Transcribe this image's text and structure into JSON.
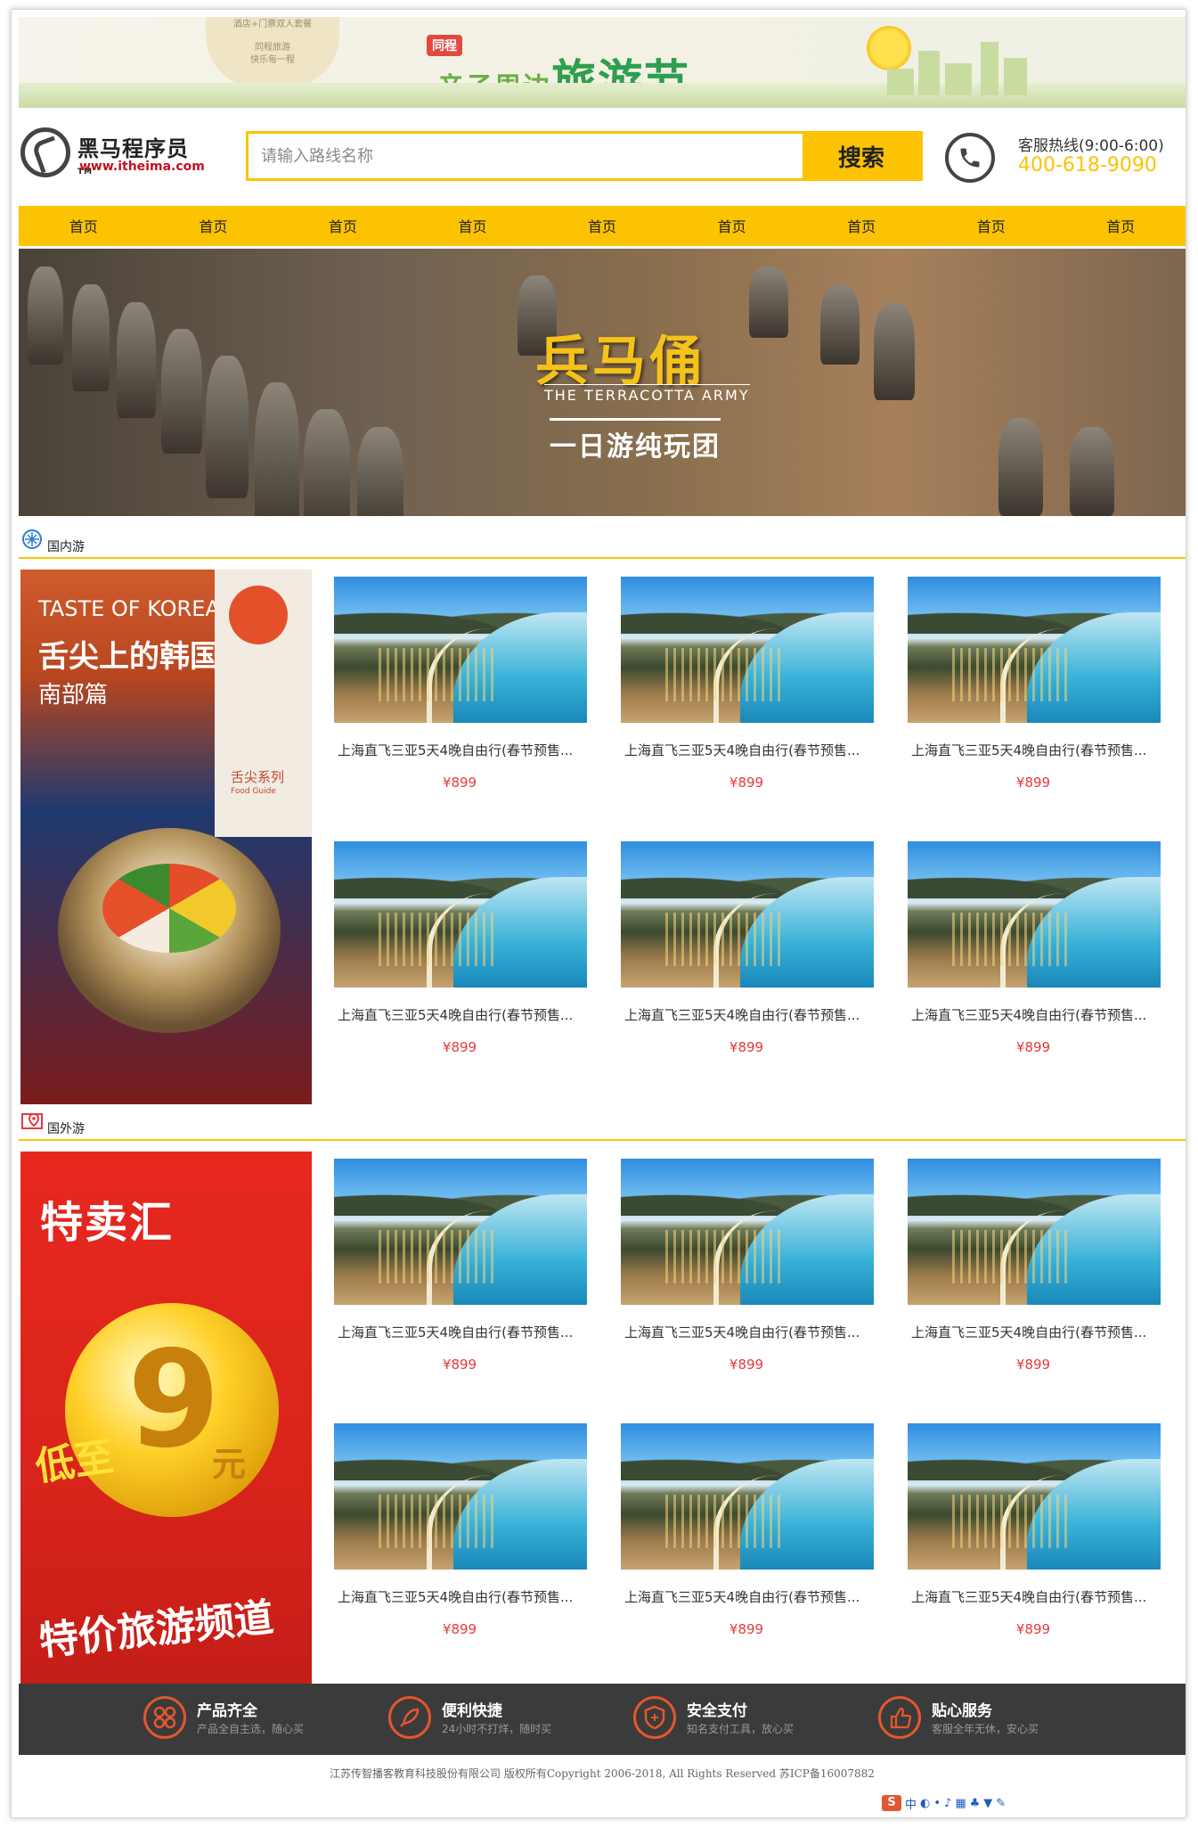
{
  "top_banner": {
    "bubble_line1": "酒店+门票双人套餐",
    "bubble_line2": "同程旅游",
    "bubble_line3": "快乐每一程",
    "tag": "同程",
    "small_text": "亲子周边",
    "big_text": "旅游节"
  },
  "header": {
    "logo_name": "黑马程序员",
    "logo_tm": "TM",
    "logo_url": "www.itheima.com",
    "search_placeholder": "请输入路线名称",
    "search_button": "搜索",
    "hotline_label": "客服热线(9:00-6:00)",
    "hotline_number": "400-618-9090"
  },
  "nav": [
    "首页",
    "首页",
    "首页",
    "首页",
    "首页",
    "首页",
    "首页",
    "首页",
    "首页"
  ],
  "hero": {
    "title": "兵马俑",
    "subtitle": "THE TERRACOTTA ARMY",
    "tagline": "一日游纯玩团"
  },
  "sections": [
    {
      "label": "国内游",
      "icon": "compass-icon",
      "ad": {
        "line1": "TASTE OF KOREA",
        "line2": "舌尖上的韩国",
        "line3": "南部篇",
        "series": "舌尖系列",
        "guide": "Food Guide"
      },
      "items": [
        {
          "name": "上海直飞三亚5天4晚自由行(春节预售...",
          "price": "¥899"
        },
        {
          "name": "上海直飞三亚5天4晚自由行(春节预售...",
          "price": "¥899"
        },
        {
          "name": "上海直飞三亚5天4晚自由行(春节预售...",
          "price": "¥899"
        },
        {
          "name": "上海直飞三亚5天4晚自由行(春节预售...",
          "price": "¥899"
        },
        {
          "name": "上海直飞三亚5天4晚自由行(春节预售...",
          "price": "¥899"
        },
        {
          "name": "上海直飞三亚5天4晚自由行(春节预售...",
          "price": "¥899"
        }
      ]
    },
    {
      "label": "国外游",
      "icon": "map-pin-icon",
      "ad": {
        "line1": "特卖汇",
        "nine": "9",
        "yuan": "元",
        "low": "低至",
        "channel": "特价旅游频道"
      },
      "items": [
        {
          "name": "上海直飞三亚5天4晚自由行(春节预售...",
          "price": "¥899"
        },
        {
          "name": "上海直飞三亚5天4晚自由行(春节预售...",
          "price": "¥899"
        },
        {
          "name": "上海直飞三亚5天4晚自由行(春节预售...",
          "price": "¥899"
        },
        {
          "name": "上海直飞三亚5天4晚自由行(春节预售...",
          "price": "¥899"
        },
        {
          "name": "上海直飞三亚5天4晚自由行(春节预售...",
          "price": "¥899"
        },
        {
          "name": "上海直飞三亚5天4晚自由行(春节预售...",
          "price": "¥899"
        }
      ]
    }
  ],
  "features": [
    {
      "title": "产品齐全",
      "sub": "产品全自主选，随心买",
      "icon": "grid-icon"
    },
    {
      "title": "便利快捷",
      "sub": "24小时不打烊，随时买",
      "icon": "rocket-icon"
    },
    {
      "title": "安全支付",
      "sub": "知名支付工具，放心买",
      "icon": "shield-icon"
    },
    {
      "title": "贴心服务",
      "sub": "客服全年无休，安心买",
      "icon": "thumbs-up-icon"
    }
  ],
  "copyright": "江苏传智播客教育科技股份有限公司 版权所有Copyright 2006-2018, All Rights Reserved 苏ICP备16007882",
  "ime": {
    "logo": "S",
    "lang": "中"
  },
  "colors": {
    "accent": "#fbc302",
    "price": "#e4393c",
    "footer_bg": "#3b3b3b",
    "feature_icon": "#e4572e"
  }
}
